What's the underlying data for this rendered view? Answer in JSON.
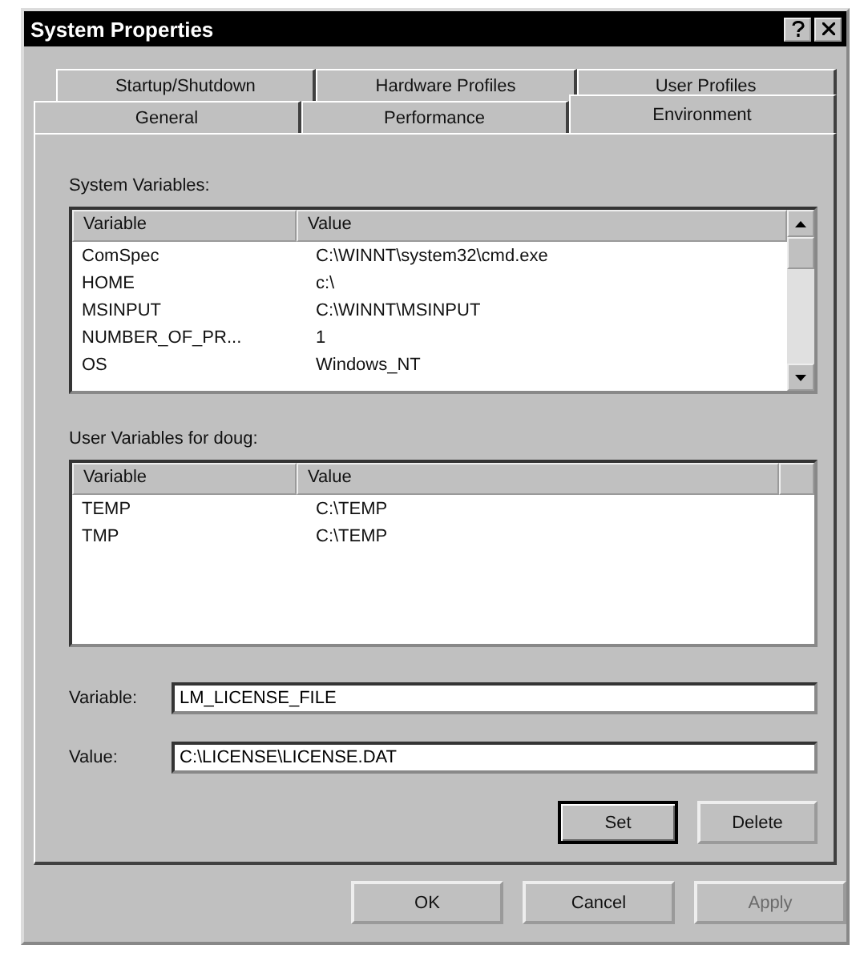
{
  "window": {
    "title": "System Properties"
  },
  "tab_rows": [
    {
      "tabs": [
        {
          "label": "Startup/Shutdown",
          "selected": false
        },
        {
          "label": "Hardware Profiles",
          "selected": false
        },
        {
          "label": "User Profiles",
          "selected": false
        }
      ]
    },
    {
      "tabs": [
        {
          "label": "General",
          "selected": false
        },
        {
          "label": "Performance",
          "selected": false
        },
        {
          "label": "Environment",
          "selected": true
        }
      ]
    }
  ],
  "system_variables": {
    "label": "System Variables:",
    "scrollbar": true,
    "columns": [
      "Variable",
      "Value"
    ],
    "rows": [
      {
        "variable": "ComSpec",
        "value": "C:\\WINNT\\system32\\cmd.exe"
      },
      {
        "variable": "HOME",
        "value": "c:\\"
      },
      {
        "variable": "MSINPUT",
        "value": "C:\\WINNT\\MSINPUT"
      },
      {
        "variable": "NUMBER_OF_PR...",
        "value": "1"
      },
      {
        "variable": "OS",
        "value": "Windows_NT"
      }
    ]
  },
  "user_variables": {
    "label": "User Variables for doug:",
    "scrollbar": false,
    "columns": [
      "Variable",
      "Value"
    ],
    "rows": [
      {
        "variable": "TEMP",
        "value": "C:\\TEMP"
      },
      {
        "variable": "TMP",
        "value": "C:\\TEMP"
      }
    ]
  },
  "fields": [
    {
      "label": "Variable:",
      "value": "LM_LICENSE_FILE"
    },
    {
      "label": "Value:",
      "value": "C:\\LICENSE\\LICENSE.DAT"
    }
  ],
  "panel_buttons": [
    {
      "label": "Set",
      "default": true,
      "disabled": false
    },
    {
      "label": "Delete",
      "default": false,
      "disabled": false
    }
  ],
  "dialog_buttons": [
    {
      "label": "OK",
      "default": false,
      "disabled": false
    },
    {
      "label": "Cancel",
      "default": false,
      "disabled": false
    },
    {
      "label": "Apply",
      "default": false,
      "disabled": true
    }
  ]
}
